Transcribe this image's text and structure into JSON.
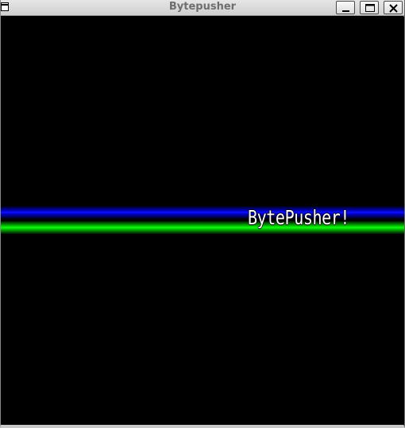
{
  "window": {
    "title": "Bytepusher",
    "system_icon": "window-menu-icon",
    "buttons": {
      "minimize_icon": "minimize-icon",
      "maximize_icon": "maximize-icon",
      "close_icon": "close-icon"
    }
  },
  "screen": {
    "background_color": "#000000",
    "banner_text": "BytePusher!",
    "bars": [
      {
        "name": "blue-bar",
        "color": "#0000ff"
      },
      {
        "name": "green-bar",
        "color": "#00ff00"
      }
    ]
  }
}
